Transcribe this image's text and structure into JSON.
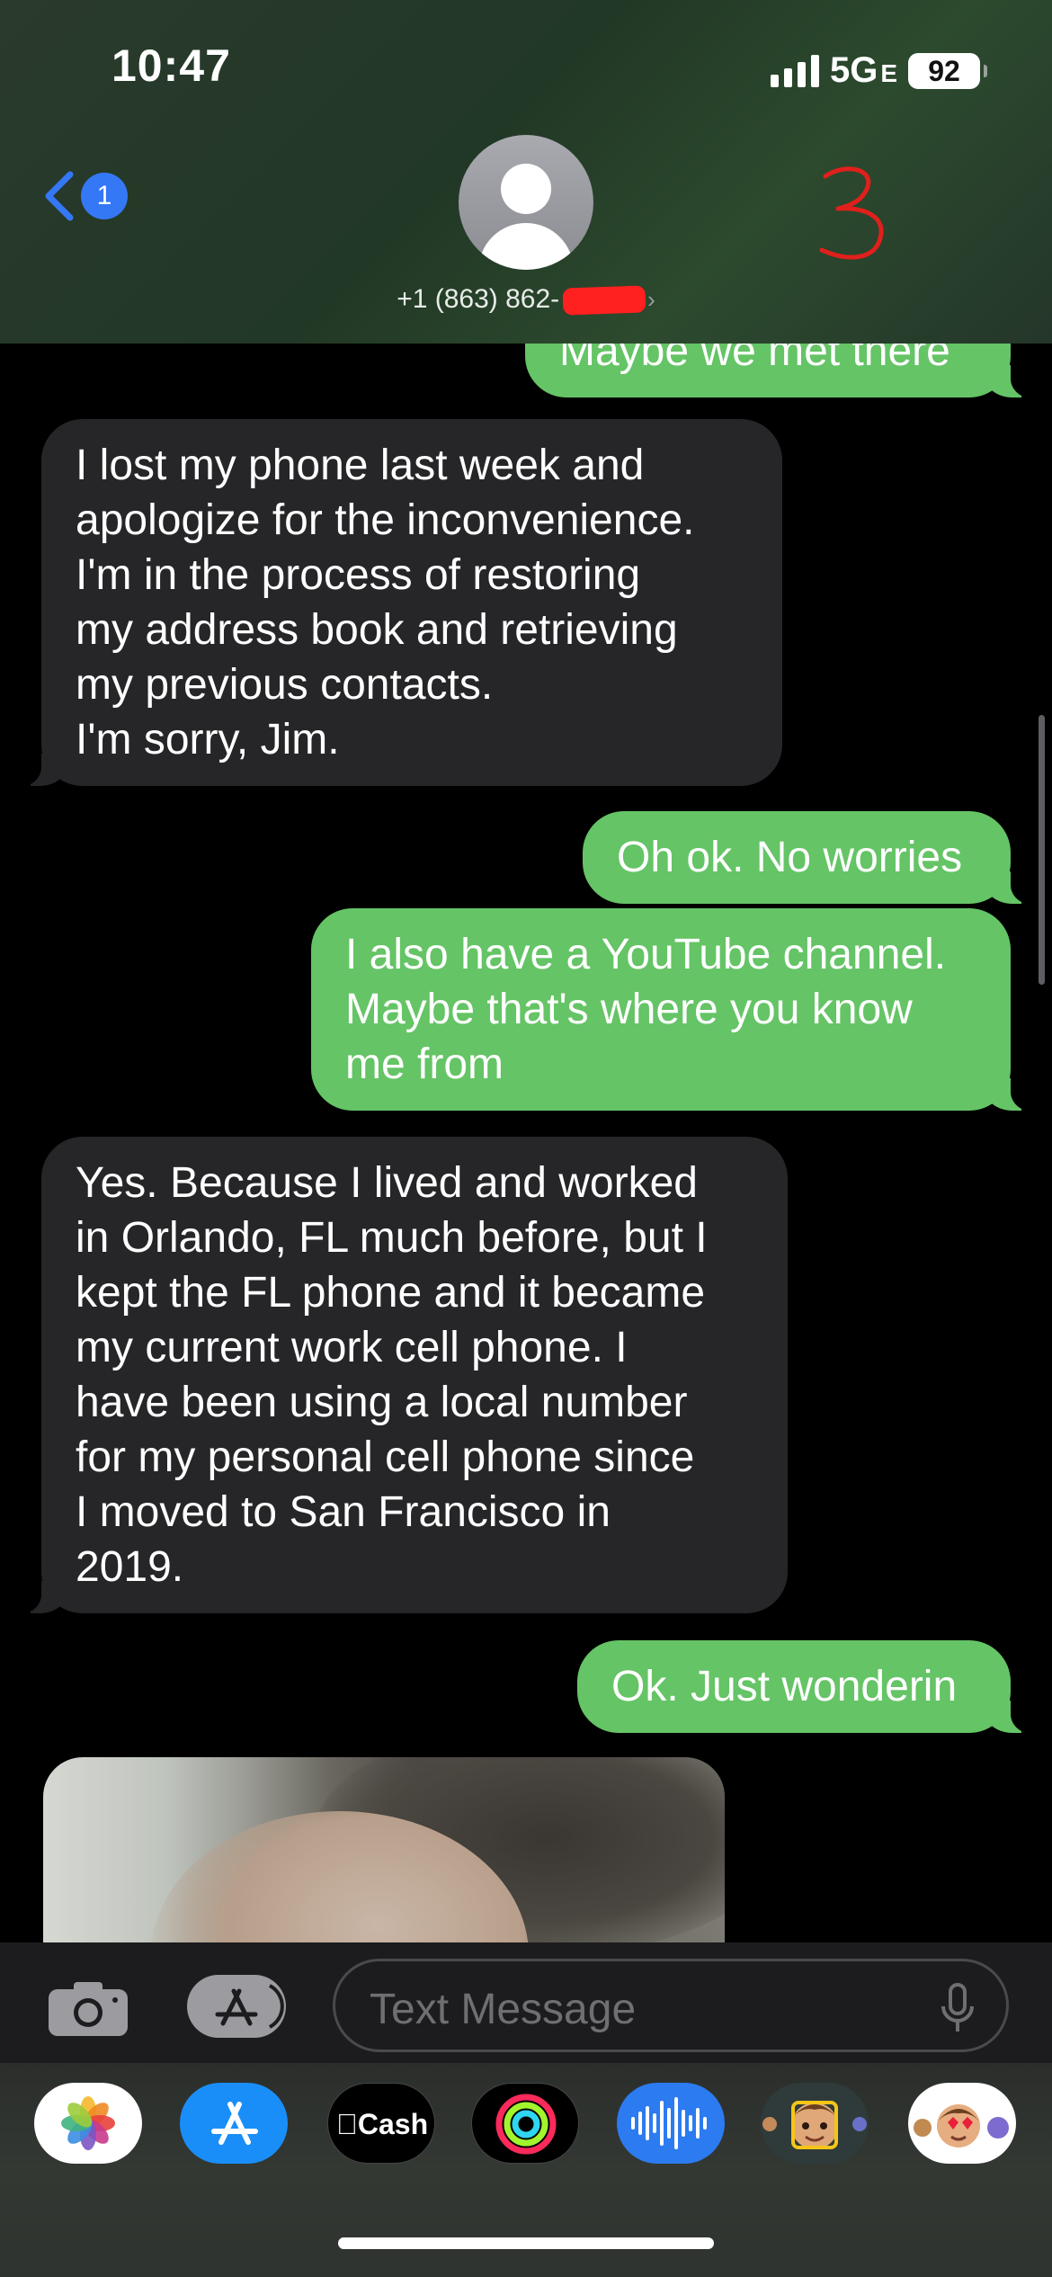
{
  "status_bar": {
    "time": "10:47",
    "network": "5G",
    "network_suffix": "E",
    "battery": "92"
  },
  "header": {
    "back_badge": "1",
    "contact_prefix": "+1 (863) 862-",
    "contact_chevron": "›",
    "annotation": "3"
  },
  "messages": [
    {
      "direction": "out",
      "lines": [
        "Maybe we met there"
      ]
    },
    {
      "direction": "in",
      "lines": [
        "I lost my phone last week and",
        "apologize for the inconvenience.",
        "I'm in the process of restoring",
        "my address book and retrieving",
        "my previous contacts.",
        "I'm sorry, Jim."
      ]
    },
    {
      "direction": "out",
      "lines": [
        "Oh ok. No worries"
      ]
    },
    {
      "direction": "out",
      "lines": [
        "I also have a YouTube channel.",
        "Maybe that's where you know",
        "me from"
      ]
    },
    {
      "direction": "in",
      "lines": [
        "Yes. Because I lived and worked",
        "in Orlando, FL much before, but I",
        "kept the FL phone and it became",
        "my current work cell phone. I",
        "have been using a local number",
        "for my personal cell phone since",
        "I moved to San Francisco in",
        "2019."
      ]
    },
    {
      "direction": "out",
      "lines": [
        "Ok. Just wonderin"
      ]
    }
  ],
  "input": {
    "placeholder": "Text Message"
  },
  "app_drawer": {
    "apps": [
      "photos-icon",
      "app-store-icon",
      "apple-cash-icon",
      "activity-icon",
      "audio-message-icon",
      "memoji-icon",
      "memoji-stickers-icon"
    ],
    "cash_label": "Cash"
  },
  "colors": {
    "outgoing_bubble": "#65c466",
    "incoming_bubble": "#262628",
    "accent": "#3478f6",
    "annotation": "#e0201c"
  }
}
